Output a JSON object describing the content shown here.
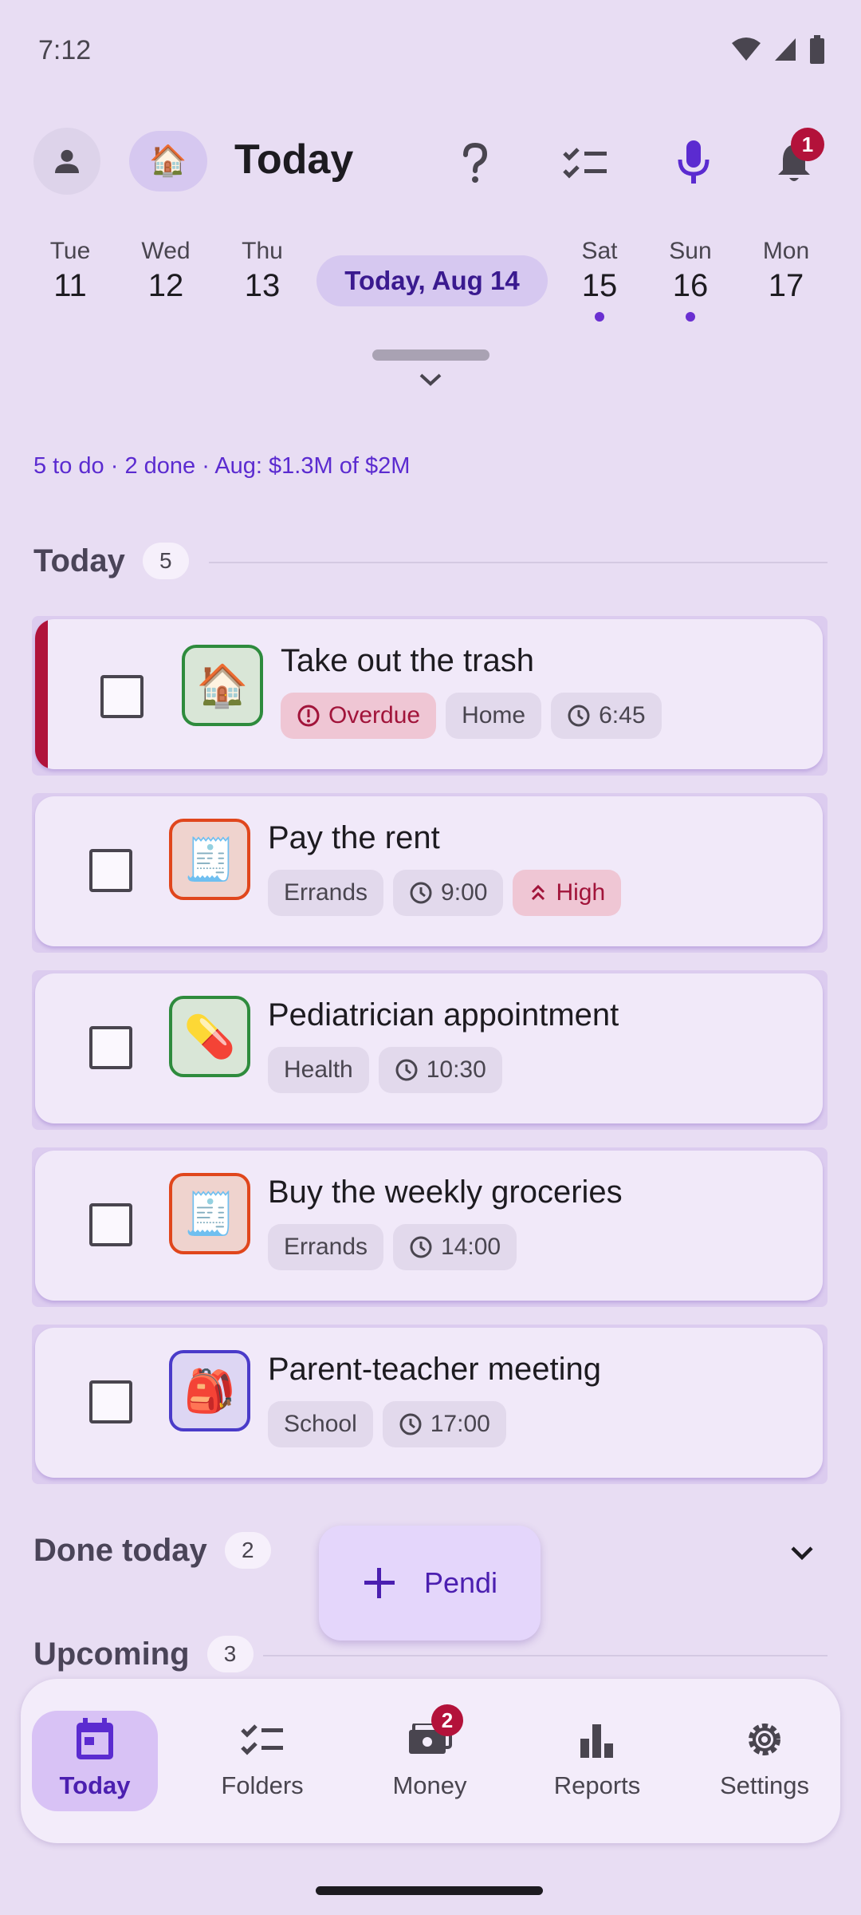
{
  "status_bar": {
    "time": "7:12"
  },
  "app_bar": {
    "title": "Today",
    "home_emoji": "🏠",
    "notification_count": "1"
  },
  "date_strip": {
    "days": [
      {
        "dow": "Tue",
        "num": "11",
        "has_dot": false
      },
      {
        "dow": "Wed",
        "num": "12",
        "has_dot": false
      },
      {
        "dow": "Thu",
        "num": "13",
        "has_dot": false
      },
      {
        "dow": "Sat",
        "num": "15",
        "has_dot": true
      },
      {
        "dow": "Sun",
        "num": "16",
        "has_dot": true
      },
      {
        "dow": "Mon",
        "num": "17",
        "has_dot": false
      }
    ],
    "selected": "Today, Aug 14"
  },
  "summary": "5 to do · 2 done · Aug: $1.3M of $2M",
  "sections": {
    "today": {
      "title": "Today",
      "count": "5"
    },
    "done_today": {
      "title": "Done today",
      "count": "2"
    },
    "upcoming": {
      "title": "Upcoming",
      "count": "3"
    }
  },
  "tasks": [
    {
      "title": "Take out the trash",
      "emoji": "🏠",
      "icon_color": "#2e8b3d",
      "overdue_label": "Overdue",
      "category": "Home",
      "time": "6:45"
    },
    {
      "title": "Pay the rent",
      "emoji": "🧾",
      "icon_color": "#e0461c",
      "category": "Errands",
      "time": "9:00",
      "priority": "High"
    },
    {
      "title": "Pediatrician appointment",
      "emoji": "💊",
      "icon_color": "#2e8b3d",
      "category": "Health",
      "time": "10:30"
    },
    {
      "title": "Buy the weekly groceries",
      "emoji": "🧾",
      "icon_color": "#e0461c",
      "category": "Errands",
      "time": "14:00"
    },
    {
      "title": "Parent-teacher meeting",
      "emoji": "🎒",
      "icon_color": "#4a3bc9",
      "category": "School",
      "time": "17:00"
    }
  ],
  "fab": {
    "label": "Pendi"
  },
  "bottom_nav": {
    "items": [
      {
        "label": "Today"
      },
      {
        "label": "Folders"
      },
      {
        "label": "Money"
      },
      {
        "label": "Reports"
      },
      {
        "label": "Settings"
      }
    ],
    "money_badge": "2"
  },
  "colors": {
    "accent": "#5b2bd0",
    "danger": "#b3123a",
    "background": "#e8ddf3"
  }
}
